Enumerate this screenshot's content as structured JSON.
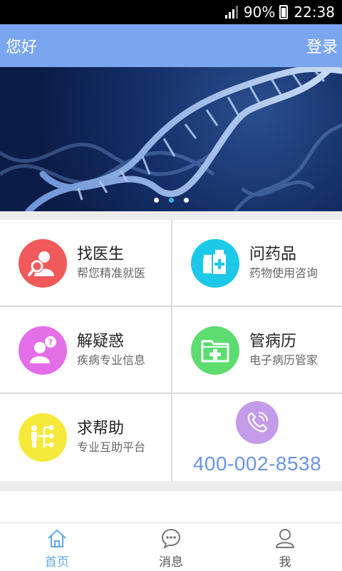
{
  "status_bar": {
    "battery": "90%",
    "time": "22:38"
  },
  "header": {
    "greeting": "您好",
    "login": "登录"
  },
  "banner": {
    "dots": 3,
    "active_dot": 2
  },
  "features": [
    {
      "title": "找医生",
      "subtitle": "帮您精准就医",
      "icon": "doctor-search-icon",
      "color": "#f05a5a"
    },
    {
      "title": "问药品",
      "subtitle": "药物使用咨询",
      "icon": "medicine-icon",
      "color": "#1cc9e8"
    },
    {
      "title": "解疑惑",
      "subtitle": "疾病专业信息",
      "icon": "question-person-icon",
      "color": "#e46ee7"
    },
    {
      "title": "管病历",
      "subtitle": "电子病历管家",
      "icon": "medical-folder-icon",
      "color": "#5ddc6f"
    },
    {
      "title": "求帮助",
      "subtitle": "专业互助平台",
      "icon": "help-network-icon",
      "color": "#f5ea3c"
    }
  ],
  "hotline": {
    "number": "400-002-8538",
    "icon": "phone-icon",
    "color": "#c39be9"
  },
  "tabs": [
    {
      "label": "首页",
      "icon": "home-icon",
      "active": true
    },
    {
      "label": "消息",
      "icon": "message-icon",
      "active": false
    },
    {
      "label": "我",
      "icon": "user-icon",
      "active": false
    }
  ]
}
